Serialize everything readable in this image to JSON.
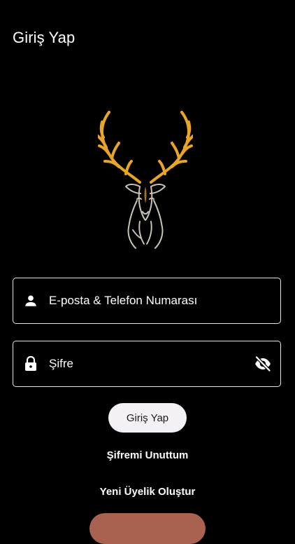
{
  "header": {
    "title": "Giriş Yap"
  },
  "logo": {
    "icon": "deer-antlers-logo",
    "accent_color": "#e9a528",
    "outline_color": "#c9c2b6"
  },
  "form": {
    "email": {
      "icon": "person-icon",
      "placeholder": "E-posta & Telefon Numarası"
    },
    "password": {
      "icon": "lock-icon",
      "placeholder": "Şifre",
      "toggle_icon": "eye-off-icon"
    },
    "submit_label": "Giriş Yap"
  },
  "links": {
    "forgot_password": "Şifremi Unuttum",
    "register": "Yeni Üyelik Oluştur"
  },
  "bottom_button": {
    "label": "",
    "color": "#a8624f"
  }
}
